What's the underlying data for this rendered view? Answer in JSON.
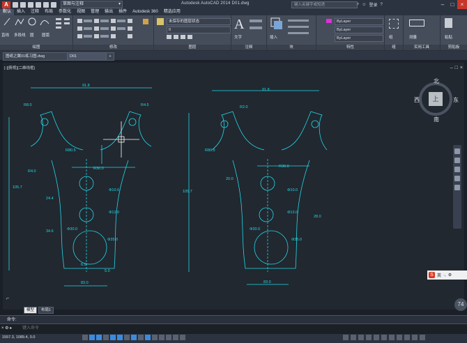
{
  "titlebar": {
    "workspace": "草图与注释",
    "app_title": "Autodesk AutoCAD 2014    D01.dwg",
    "search_placeholder": "键入关键字或短语",
    "user": "登录"
  },
  "ribbon_tabs": [
    "默认",
    "插入",
    "注释",
    "布局",
    "参数化",
    "视图",
    "管理",
    "输出",
    "插件",
    "Autodesk 360",
    "精选应用"
  ],
  "ribbon_panels": {
    "draw": "绘图",
    "modify": "修改",
    "layers": "图层",
    "annotation": "注释",
    "block": "块",
    "properties": "特性",
    "groups": "组",
    "utilities": "实用工具",
    "clipboard": "剪贴板"
  },
  "ribbon_labels": {
    "line": "直线",
    "polyline": "多段线",
    "circle": "圆",
    "arc": "圆弧",
    "text": "文字",
    "insert": "插入",
    "measure": "测量",
    "paste": "粘贴",
    "group": "组",
    "layer_state": "未保存的图层状态",
    "layer_current": "0",
    "bylayer": "ByLayer"
  },
  "doc_tabs": [
    "图纸之翼01练习图.dwg",
    "D01"
  ],
  "viewport_label": "[-][俯视][二维线框]",
  "viewcube": {
    "north": "北",
    "south": "南",
    "east": "东",
    "west": "西",
    "face": "上"
  },
  "layout_tabs": [
    "模型",
    "布局1"
  ],
  "command": {
    "history": "命令:",
    "placeholder": "键入命令"
  },
  "status": {
    "coords": "1557.3, 1089.4, 0.0",
    "zoom_badge": "74"
  },
  "ime": {
    "label": "英"
  },
  "dimensions": {
    "top_width": "91.8",
    "left_height": "105.7",
    "bottom_width": "83.0",
    "r1": "R8.0",
    "r2": "R4.5",
    "phi1": "Φ10.0",
    "phi2": "Φ13.0",
    "phi3": "Φ30.0",
    "phi4": "Φ35.0",
    "r3": "R80.5",
    "r4": "R30.0",
    "r5": "R4.0",
    "r6": "R2.0",
    "d1": "24.4",
    "d2": "34.6",
    "d3": "20.0",
    "d4": "28.0",
    "d5": "6.0",
    "d6": "5.0"
  }
}
